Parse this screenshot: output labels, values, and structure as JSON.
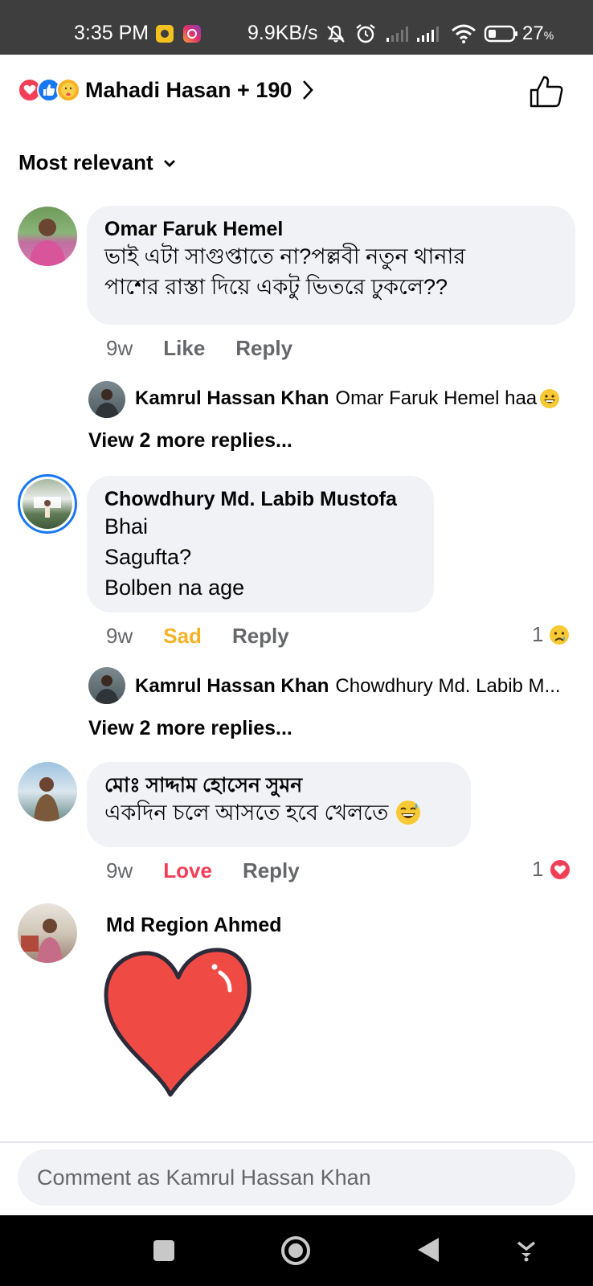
{
  "status_bar": {
    "time": "3:35 PM",
    "speed": "9.9KB/s",
    "battery_percent": "27",
    "battery_unit": "%",
    "icons": [
      "mute-bell-icon",
      "alarm-icon",
      "signal-icon",
      "signal-icon",
      "wifi-icon",
      "battery-icon"
    ]
  },
  "reactions_header": {
    "label": "Mahadi Hasan + 190",
    "icons": [
      "love-reaction-icon",
      "like-reaction-icon",
      "care-reaction-icon"
    ]
  },
  "sort": {
    "label": "Most relevant"
  },
  "comments": [
    {
      "name": "Omar Faruk Hemel",
      "text_lines": [
        "ভাই এটা সাগুপ্তাতে না?পল্লবী নতুন থানার",
        "পাশের রাস্তা দিয়ে একটু ভিতরে ঢুকলে??"
      ],
      "time": "9w",
      "reaction_label": "Like",
      "reply_label": "Reply",
      "reply": {
        "name": "Kamrul Hassan Khan",
        "text": "Omar Faruk Hemel haa"
      },
      "more_replies": "View 2 more replies..."
    },
    {
      "name": "Chowdhury Md. Labib Mustofa",
      "text_lines": [
        "Bhai",
        "Sagufta?",
        "Bolben na age"
      ],
      "time": "9w",
      "reaction_label": "Sad",
      "reply_label": "Reply",
      "reaction_count": "1",
      "reply": {
        "name": "Kamrul Hassan Khan",
        "text": "Chowdhury Md. Labib M..."
      },
      "more_replies": "View 2 more replies..."
    },
    {
      "name": "মোঃ সাদ্দাম হোসেন সুমন",
      "text_lines": [
        "একদিন চলে আসতে হবে খেলতে"
      ],
      "time": "9w",
      "reaction_label": "Love",
      "reply_label": "Reply",
      "reaction_count": "1"
    },
    {
      "name": "Md Region Ahmed",
      "sticker": "heart-sticker"
    }
  ],
  "composer": {
    "placeholder": "Comment as Kamrul Hassan Khan"
  },
  "colors": {
    "status_bar": "#3e3e3e",
    "bubble": "#f0f2f5",
    "secondary_text": "#65676b",
    "sad": "#f7b125",
    "love": "#f33e58",
    "like_blue": "#1877f2",
    "highlight_ring": "#1877f2"
  }
}
